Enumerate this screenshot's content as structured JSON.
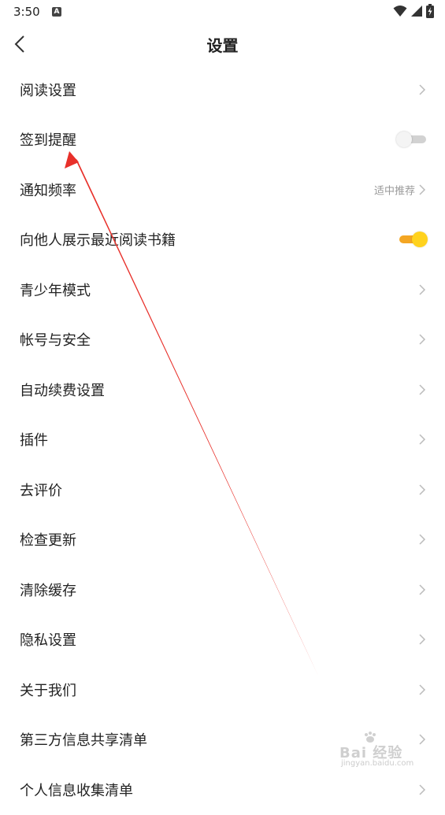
{
  "status_bar": {
    "time": "3:50",
    "notification_icon": "A"
  },
  "header": {
    "title": "设置"
  },
  "settings": [
    {
      "label": "阅读设置",
      "type": "chevron"
    },
    {
      "label": "签到提醒",
      "type": "toggle",
      "on": false
    },
    {
      "label": "通知频率",
      "type": "chevron",
      "value": "适中推荐"
    },
    {
      "label": "向他人展示最近阅读书籍",
      "type": "toggle",
      "on": true
    },
    {
      "label": "青少年模式",
      "type": "chevron"
    },
    {
      "label": "帐号与安全",
      "type": "chevron"
    },
    {
      "label": "自动续费设置",
      "type": "chevron"
    },
    {
      "label": "插件",
      "type": "chevron"
    },
    {
      "label": "去评价",
      "type": "chevron"
    },
    {
      "label": "检查更新",
      "type": "chevron"
    },
    {
      "label": "清除缓存",
      "type": "chevron"
    },
    {
      "label": "隐私设置",
      "type": "chevron"
    },
    {
      "label": "关于我们",
      "type": "chevron"
    },
    {
      "label": "第三方信息共享清单",
      "type": "chevron"
    },
    {
      "label": "个人信息收集清单",
      "type": "chevron"
    }
  ],
  "watermark": {
    "brand": "Bai 经验",
    "site": "jingyan.baidu.com"
  },
  "colors": {
    "accent": "#f4a623",
    "toggle_thumb_on": "#ffd21e",
    "annotation_arrow": "#e8302a"
  },
  "icons": {
    "back": "chevron-left-icon",
    "row": "chevron-right-icon",
    "wifi": "wifi-icon",
    "signal": "signal-icon",
    "battery": "battery-charging-icon"
  }
}
